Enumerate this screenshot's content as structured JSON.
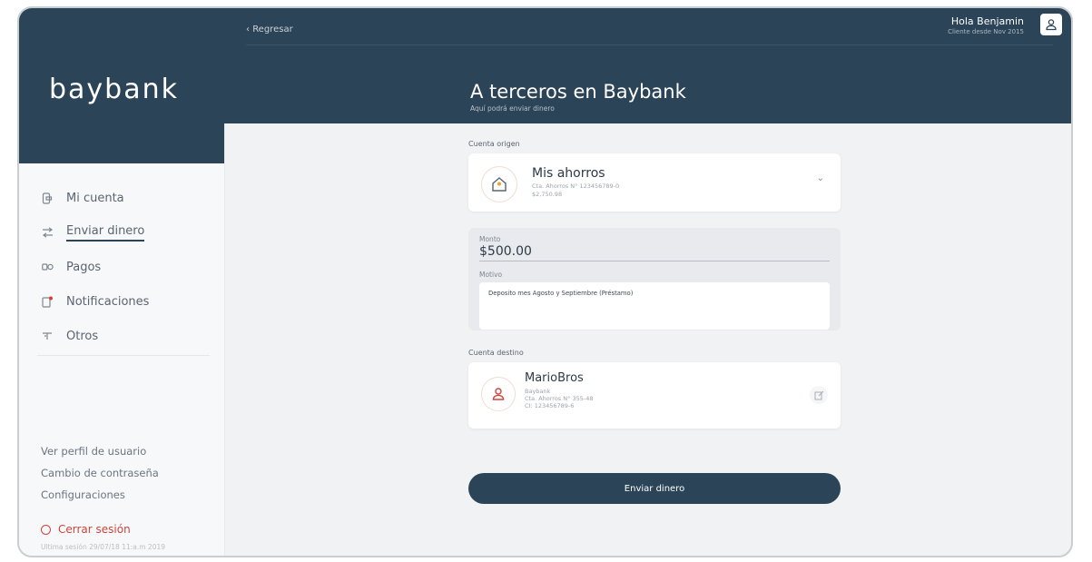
{
  "app": {
    "logo": "baybank"
  },
  "sidebar": {
    "items": [
      {
        "label": "Mi cuenta",
        "icon": "wallet-icon"
      },
      {
        "label": "Enviar dinero",
        "icon": "transfer-icon"
      },
      {
        "label": "Pagos",
        "icon": "payments-icon"
      },
      {
        "label": "Notificaciones",
        "icon": "bell-icon"
      },
      {
        "label": "Otros",
        "icon": "other-icon"
      }
    ],
    "links": [
      "Ver perfil de usuario",
      "Cambio de contraseña",
      "Configuraciones"
    ],
    "logout": "Cerrar sesión",
    "last_session": "Ultima sesión 29/07/18 11:a.m 2019"
  },
  "header": {
    "back_label": "Regresar",
    "greeting": "Hola Benjamin",
    "since": "Cliente desde Nov 2015",
    "title": "A terceros en Baybank",
    "subtitle": "Aquí podrá enviar dinero"
  },
  "origin": {
    "label": "Cuenta origen",
    "name": "Mis ahorros",
    "detail": "Cta. Ahorros N° 123456789-0",
    "balance": "$2,750.98"
  },
  "form": {
    "amount_label": "Monto",
    "amount": "$500.00",
    "reason_label": "Motivo",
    "reason": "Deposito mes Agosto y Septiembre (Préstamo)"
  },
  "destination": {
    "label": "Cuenta destino",
    "name": "MarioBros",
    "bank": "Baybank",
    "account": "Cta. Ahorros N° 355-48",
    "ci": "CI: 123456789-6"
  },
  "actions": {
    "send": "Enviar dinero"
  },
  "colors": {
    "primary": "#2c4457",
    "accent": "#d0433a",
    "background": "#f1f2f4"
  }
}
